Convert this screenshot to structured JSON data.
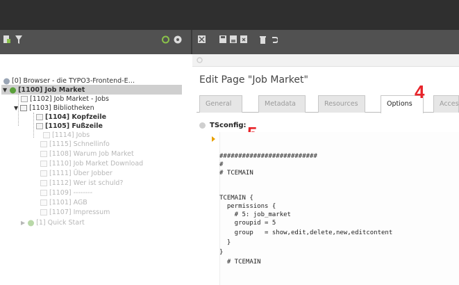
{
  "tree": {
    "root": "[0] Browser - die TYPO3-Frontend-E…",
    "items": [
      "[1100] Job Market",
      "[1102] Job Market - Jobs",
      "[1103] Bibliotheken",
      "[1104] Kopfzeile",
      "[1105] Fußzeile",
      "[1114] Jobs",
      "[1115] Schnellinfo",
      "[1108] Warum Job Market",
      "[1110] Job Market Download",
      "[1111] Über Jobber",
      "[1112] Wer ist schuld?",
      "[1109] --------",
      "[1101] AGB",
      "[1107] Impressum",
      "[1] Quick Start"
    ]
  },
  "editor": {
    "title": "Edit Page \"Job Market\"",
    "tabs": [
      "General",
      "Metadata",
      "Resources",
      "Options",
      "Access"
    ],
    "field_label": "TSconfig:",
    "code": [
      "##########################",
      "#",
      "# TCEMAIN",
      "",
      "TCEMAIN {",
      "  permissions {",
      "    # 5: job_market",
      "    groupid = 5",
      "    group   = show,edit,delete,new,editcontent",
      "  }",
      "}",
      "  # TCEMAIN"
    ]
  },
  "annotations": {
    "step_tab": "4",
    "step_field": "5",
    "color": "#e8242a"
  },
  "icons": [
    "new-page-icon",
    "filter-icon",
    "refresh-icon",
    "help-icon",
    "close-icon",
    "save-icon",
    "save-view-icon",
    "save-close-icon",
    "delete-icon",
    "undo-icon"
  ],
  "colors": {
    "topbar": "#2f2f2f",
    "toolbar": "#515151",
    "accent": "#e8a000",
    "page_icon_green": "#5aa03a"
  }
}
